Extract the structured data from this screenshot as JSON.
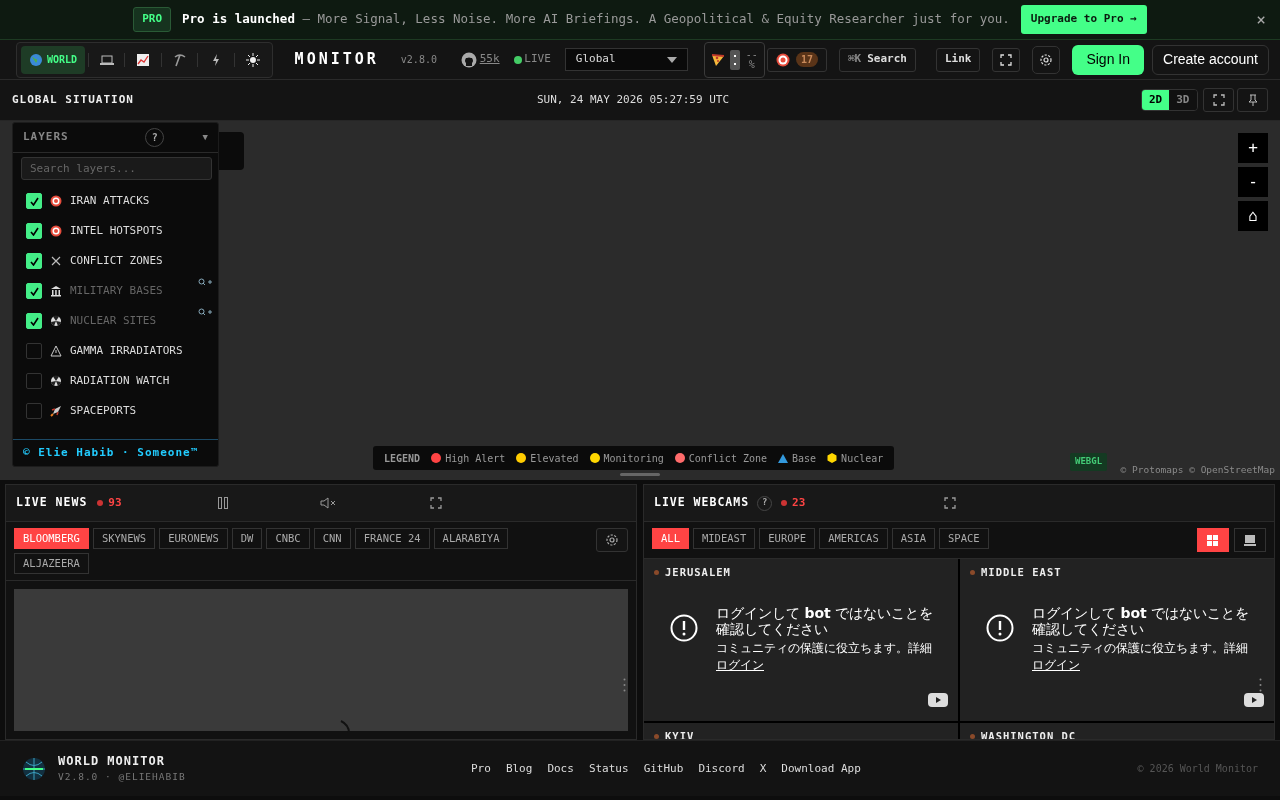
{
  "banner": {
    "badge": "PRO",
    "message": "**Pro is launched** — More Signal, Less Noise. More AI Briefings. A Geopolitical & Equity Researcher just for you.",
    "button": "Upgrade to Pro →",
    "close": "×"
  },
  "header": {
    "variants": [
      {
        "label": "WORLD",
        "selected": true
      },
      {
        "selected": false
      },
      {
        "selected": false
      },
      {
        "selected": false
      },
      {
        "selected": false
      },
      {
        "selected": false
      }
    ],
    "title": "MONITOR",
    "version": "v2.8.0",
    "stars": "55k",
    "live": "LIVE",
    "region": "Global",
    "pizza_value": "--",
    "pizza_unit": "%",
    "alerts": "17",
    "search_key": "⌘K",
    "search": "Search",
    "link": "Link",
    "sign_in": "Sign In",
    "create_account": "Create account"
  },
  "map": {
    "title": "GLOBAL SITUATION",
    "datetime": "SUN, 24 MAY 2026 05:27:59 UTC",
    "view_modes": [
      {
        "label": "2D",
        "selected": true
      },
      {
        "label": "3D",
        "selected": false
      }
    ],
    "layers": {
      "title": "LAYERS",
      "help": "?",
      "collapse": "▼",
      "placeholder": "Search layers...",
      "items": [
        {
          "label": "IRAN ATTACKS",
          "checked": true,
          "dimmed": false,
          "zoom_hint": false
        },
        {
          "label": "INTEL HOTSPOTS",
          "checked": true,
          "dimmed": false,
          "zoom_hint": false
        },
        {
          "label": "CONFLICT ZONES",
          "checked": true,
          "dimmed": false,
          "zoom_hint": false
        },
        {
          "label": "MILITARY BASES",
          "checked": true,
          "dimmed": true,
          "zoom_hint": true
        },
        {
          "label": "NUCLEAR SITES",
          "checked": true,
          "dimmed": true,
          "zoom_hint": true
        },
        {
          "label": "GAMMA IRRADIATORS",
          "checked": false,
          "dimmed": false,
          "zoom_hint": false
        },
        {
          "label": "RADIATION WATCH",
          "checked": false,
          "dimmed": false,
          "zoom_hint": false
        },
        {
          "label": "SPACEPORTS",
          "checked": false,
          "dimmed": false,
          "zoom_hint": false
        }
      ],
      "credit": "© Elie Habib · Someone™"
    },
    "zoom_in": "+",
    "zoom_out": "-",
    "home": "⌂",
    "legend": {
      "title": "LEGEND",
      "items": [
        {
          "label": "High Alert",
          "kind": "dot",
          "color": "#ff4444"
        },
        {
          "label": "Elevated",
          "kind": "dot",
          "color": "#ffcc00"
        },
        {
          "label": "Monitoring",
          "kind": "dot",
          "color": "#ffd700"
        },
        {
          "label": "Conflict Zone",
          "kind": "dot",
          "color": "#ff6b6b"
        },
        {
          "label": "Base",
          "kind": "triangle",
          "color": "#3399dd"
        },
        {
          "label": "Nuclear",
          "kind": "hexagon",
          "color": "#ffd700"
        }
      ]
    },
    "renderer": "WEBGL",
    "attribution": "© Protomaps © OpenStreetMap"
  },
  "live_news": {
    "title": "LIVE NEWS",
    "count": "93",
    "channels": [
      {
        "label": "BLOOMBERG",
        "selected": true
      },
      {
        "label": "SKYNEWS",
        "selected": false
      },
      {
        "label": "EURONEWS",
        "selected": false
      },
      {
        "label": "DW",
        "selected": false
      },
      {
        "label": "CNBC",
        "selected": false
      },
      {
        "label": "CNN",
        "selected": false
      },
      {
        "label": "FRANCE 24",
        "selected": false
      },
      {
        "label": "ALARABIYA",
        "selected": false
      },
      {
        "label": "ALJAZEERA",
        "selected": false
      }
    ]
  },
  "live_webcams": {
    "title": "LIVE WEBCAMS",
    "help": "?",
    "count": "23",
    "filters": [
      {
        "label": "ALL",
        "selected": true
      },
      {
        "label": "MIDEAST",
        "selected": false
      },
      {
        "label": "EUROPE",
        "selected": false
      },
      {
        "label": "AMERICAS",
        "selected": false
      },
      {
        "label": "ASIA",
        "selected": false
      },
      {
        "label": "SPACE",
        "selected": false
      }
    ],
    "layout_modes": [
      {
        "selected": true
      },
      {
        "selected": false
      }
    ],
    "cams": [
      {
        "name": "JERUSALEM",
        "message": "ログインして **bot** ではないことを確認してください",
        "note": "コミュニティの保護に役立ちます。",
        "details": "詳細",
        "login": "ログイン"
      },
      {
        "name": "MIDDLE EAST",
        "message": "ログインして **bot** ではないことを確認してください",
        "note": "コミュニティの保護に役立ちます。",
        "details": "詳細",
        "login": "ログイン"
      },
      {
        "name": "KYIV"
      },
      {
        "name": "WASHINGTON DC"
      }
    ]
  },
  "footer": {
    "name": "WORLD MONITOR",
    "sub": "V2.8.0 · @ELIEHABIB",
    "links": [
      "Pro",
      "Blog",
      "Docs",
      "Status",
      "GitHub",
      "Discord",
      "X",
      "Download App"
    ],
    "copyright": "© 2026 World Monitor"
  }
}
